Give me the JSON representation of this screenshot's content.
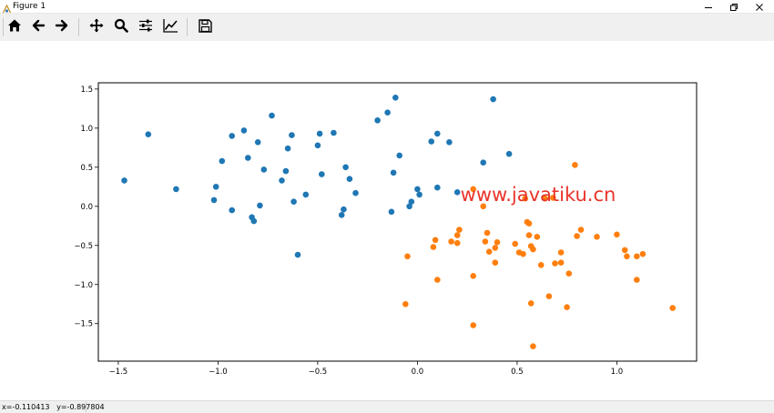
{
  "window": {
    "title": "Figure 1",
    "icons": {
      "app": "matplotlib-icon",
      "minimize": "minimize-icon",
      "maximize": "restore-icon",
      "close": "close-icon"
    }
  },
  "toolbar": {
    "buttons": [
      {
        "name": "home",
        "icon": "home-icon"
      },
      {
        "name": "back",
        "icon": "arrow-left-icon"
      },
      {
        "name": "forward",
        "icon": "arrow-right-icon"
      },
      {
        "name": "pan",
        "icon": "move-icon"
      },
      {
        "name": "zoom",
        "icon": "magnifier-icon"
      },
      {
        "name": "subplots",
        "icon": "sliders-icon"
      },
      {
        "name": "edit-axes",
        "icon": "line-chart-icon"
      },
      {
        "name": "save",
        "icon": "floppy-disk-icon"
      }
    ]
  },
  "status": {
    "text": "x=-0.110413   y=-0.897804"
  },
  "watermark": {
    "text": "www.javatiku.cn",
    "color": "#e8342a"
  },
  "colors": {
    "series0": "#1f77b4",
    "series1": "#ff7f0e",
    "frame": "#000000"
  },
  "chart_data": {
    "type": "scatter",
    "xlim": [
      -1.6,
      1.4
    ],
    "ylim": [
      -1.98,
      1.58
    ],
    "xticks": [
      -1.5,
      -1.0,
      -0.5,
      0.0,
      0.5,
      1.0
    ],
    "xtick_labels": [
      "−1.5",
      "−1.0",
      "−0.5",
      "0.0",
      "0.5",
      "1.0"
    ],
    "yticks": [
      1.5,
      1.0,
      0.5,
      0.0,
      -0.5,
      -1.0,
      -1.5
    ],
    "ytick_labels": [
      "1.5",
      "1.0",
      "0.5",
      "0.0",
      "−0.5",
      "−1.0",
      "−1.5"
    ],
    "grid": false,
    "series": [
      {
        "color": "#1f77b4",
        "points": [
          [
            -1.47,
            0.33
          ],
          [
            -1.35,
            0.92
          ],
          [
            -1.21,
            0.22
          ],
          [
            -1.02,
            0.08
          ],
          [
            -1.01,
            0.25
          ],
          [
            -0.98,
            0.58
          ],
          [
            -0.93,
            0.9
          ],
          [
            -0.93,
            -0.05
          ],
          [
            -0.87,
            0.97
          ],
          [
            -0.85,
            0.62
          ],
          [
            -0.83,
            -0.14
          ],
          [
            -0.82,
            -0.19
          ],
          [
            -0.8,
            0.82
          ],
          [
            -0.79,
            0.01
          ],
          [
            -0.77,
            0.47
          ],
          [
            -0.73,
            1.16
          ],
          [
            -0.68,
            0.33
          ],
          [
            -0.66,
            0.45
          ],
          [
            -0.65,
            0.74
          ],
          [
            -0.63,
            0.91
          ],
          [
            -0.62,
            0.06
          ],
          [
            -0.6,
            -0.62
          ],
          [
            -0.56,
            0.15
          ],
          [
            -0.5,
            0.78
          ],
          [
            -0.49,
            0.93
          ],
          [
            -0.48,
            0.41
          ],
          [
            -0.42,
            0.94
          ],
          [
            -0.38,
            -0.11
          ],
          [
            -0.37,
            -0.04
          ],
          [
            -0.36,
            0.5
          ],
          [
            -0.34,
            0.35
          ],
          [
            -0.31,
            0.17
          ],
          [
            -0.2,
            1.1
          ],
          [
            -0.15,
            1.2
          ],
          [
            -0.13,
            -0.07
          ],
          [
            -0.12,
            0.43
          ],
          [
            -0.11,
            1.39
          ],
          [
            -0.09,
            0.65
          ],
          [
            -0.04,
            0.0
          ],
          [
            -0.03,
            0.06
          ],
          [
            0.0,
            0.22
          ],
          [
            0.01,
            0.15
          ],
          [
            0.07,
            0.83
          ],
          [
            0.1,
            0.93
          ],
          [
            0.1,
            0.24
          ],
          [
            0.16,
            0.82
          ],
          [
            0.2,
            0.18
          ],
          [
            0.33,
            0.56
          ],
          [
            0.38,
            1.37
          ],
          [
            0.46,
            0.67
          ]
        ]
      },
      {
        "color": "#ff7f0e",
        "points": [
          [
            0.79,
            0.53
          ],
          [
            0.64,
            0.1
          ],
          [
            0.68,
            0.11
          ],
          [
            0.28,
            0.22
          ],
          [
            0.33,
            0.0
          ],
          [
            0.54,
            0.1
          ],
          [
            -0.06,
            -1.25
          ],
          [
            -0.05,
            -0.64
          ],
          [
            0.08,
            -0.52
          ],
          [
            0.09,
            -0.43
          ],
          [
            0.1,
            -0.94
          ],
          [
            0.17,
            -0.45
          ],
          [
            0.2,
            -0.37
          ],
          [
            0.2,
            -0.47
          ],
          [
            0.21,
            -0.3
          ],
          [
            0.28,
            -0.89
          ],
          [
            0.28,
            -1.52
          ],
          [
            0.34,
            -0.45
          ],
          [
            0.35,
            -0.34
          ],
          [
            0.36,
            -0.58
          ],
          [
            0.39,
            -0.53
          ],
          [
            0.39,
            -0.72
          ],
          [
            0.4,
            -0.46
          ],
          [
            0.49,
            -0.48
          ],
          [
            0.51,
            -0.59
          ],
          [
            0.53,
            -0.61
          ],
          [
            0.55,
            -0.2
          ],
          [
            0.56,
            -0.22
          ],
          [
            0.56,
            -0.37
          ],
          [
            0.57,
            -0.51
          ],
          [
            0.57,
            -1.24
          ],
          [
            0.58,
            -1.79
          ],
          [
            0.58,
            -0.55
          ],
          [
            0.6,
            -0.39
          ],
          [
            0.62,
            -0.75
          ],
          [
            0.66,
            -1.15
          ],
          [
            0.69,
            -0.73
          ],
          [
            0.72,
            -0.59
          ],
          [
            0.72,
            -0.72
          ],
          [
            0.75,
            -1.29
          ],
          [
            0.76,
            -0.86
          ],
          [
            0.8,
            -0.38
          ],
          [
            0.82,
            -0.3
          ],
          [
            0.9,
            -0.39
          ],
          [
            1.0,
            -0.36
          ],
          [
            1.04,
            -0.56
          ],
          [
            1.05,
            -0.64
          ],
          [
            1.1,
            -0.94
          ],
          [
            1.1,
            -0.64
          ],
          [
            1.13,
            -0.61
          ],
          [
            1.28,
            -1.3
          ]
        ]
      }
    ]
  }
}
